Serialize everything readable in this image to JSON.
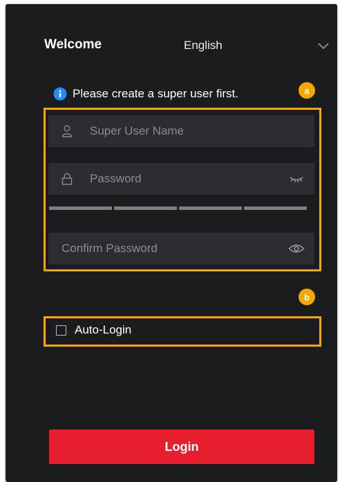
{
  "header": {
    "title": "Welcome",
    "language": "English",
    "language_icon": "chevron-down-icon"
  },
  "notice": {
    "icon": "info-icon",
    "text": "Please create a super user first."
  },
  "annotations": {
    "badge_a": "a",
    "badge_b": "b",
    "highlight_color": "#f5a800"
  },
  "form": {
    "username_placeholder": "Super User Name",
    "password_placeholder": "Password",
    "confirm_placeholder": "Confirm Password",
    "strength_segments": 4
  },
  "auto_login": {
    "label": "Auto-Login",
    "checked": false
  },
  "login_button": {
    "label": "Login",
    "color": "#e61e2e"
  }
}
